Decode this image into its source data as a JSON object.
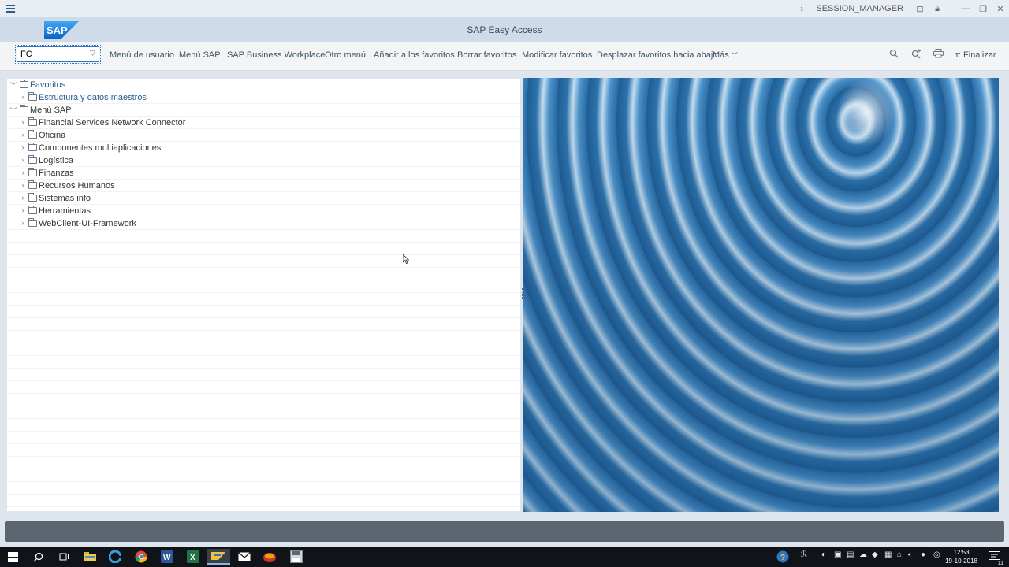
{
  "window": {
    "session": "SESSION_MANAGER",
    "title": "SAP Easy Access"
  },
  "toolbar": {
    "command_value": "FC",
    "buttons": [
      "Menú de usuario",
      "Menú SAP",
      "SAP Business Workplace",
      "Otro menú",
      "Añadir a los favoritos",
      "Borrar favoritos",
      "Modificar favoritos",
      "Desplazar favoritos hacia abajo",
      "Más"
    ],
    "finalize": "Finalizar"
  },
  "tree": {
    "favorites_label": "Favoritos",
    "favorites_items": [
      "Estructura y datos maestros"
    ],
    "sap_menu_label": "Menú SAP",
    "sap_menu_items": [
      "Financial Services Network Connector",
      "Oficina",
      "Componentes multiaplicaciones",
      "Logística",
      "Finanzas",
      "Recursos Humanos",
      "Sistemas info",
      "Herramientas",
      "WebClient-UI-Framework"
    ]
  },
  "taskbar": {
    "time": "12:53",
    "date": "19-10-2018",
    "notification_count": "11"
  },
  "colors": {
    "accent": "#2f76c2",
    "shell": "#cfdbe8",
    "status_bar": "#5b6670"
  }
}
